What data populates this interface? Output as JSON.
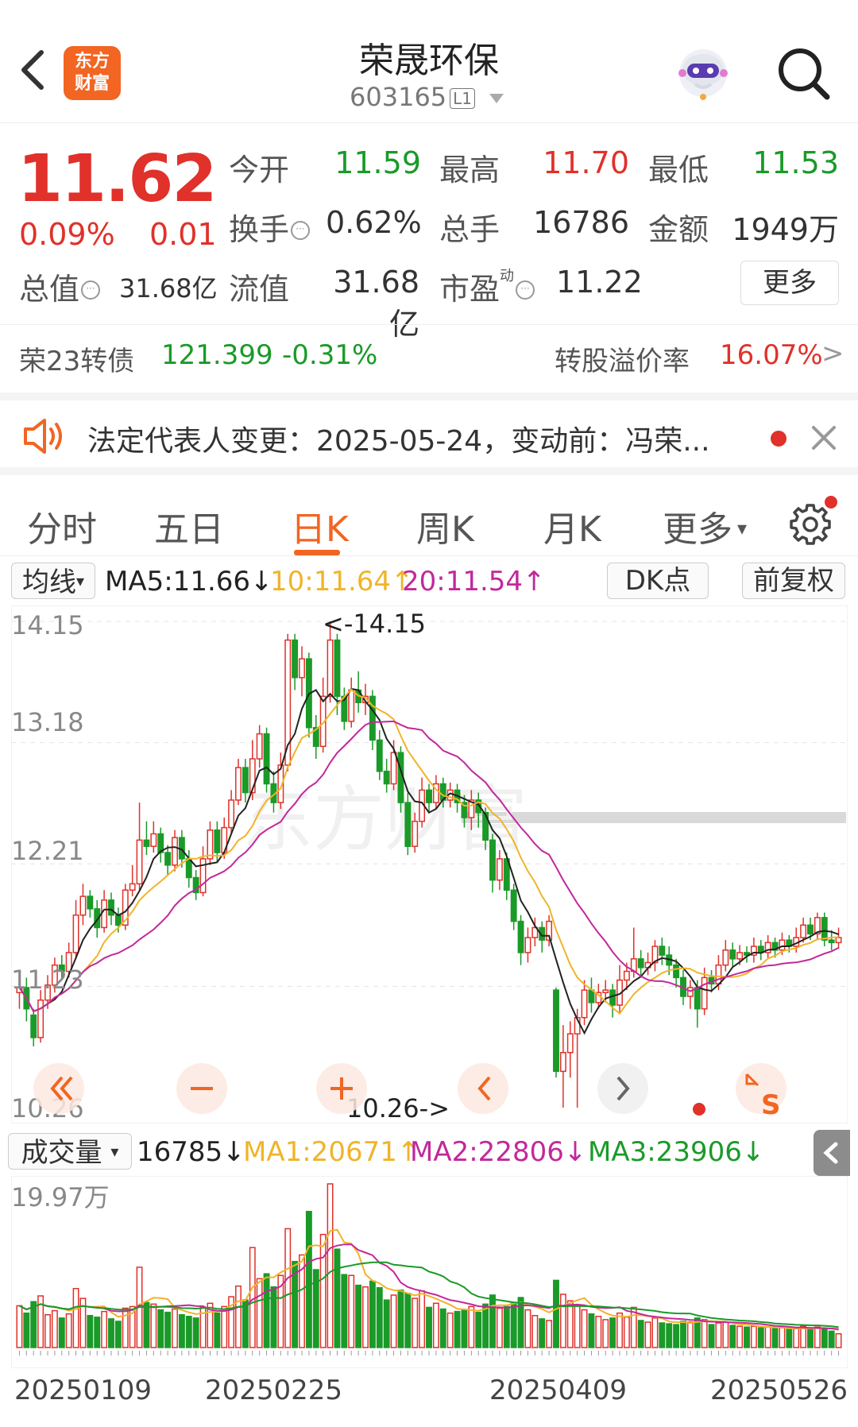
{
  "header": {
    "title": "荣晟环保",
    "code": "603165",
    "level_badge": "L1",
    "logo_line1": "东方",
    "logo_line2": "财富",
    "icons": [
      "back-arrow-icon",
      "robot-avatar-icon",
      "search-icon"
    ]
  },
  "quote": {
    "price": "11.62",
    "change_pct": "0.09%",
    "change": "0.01",
    "open_label": "今开",
    "open": "11.59",
    "high_label": "最高",
    "high": "11.70",
    "low_label": "最低",
    "low": "11.53",
    "turnover_label": "换手",
    "turnover": "0.62%",
    "volume_label": "总手",
    "volume": "16786",
    "amount_label": "金额",
    "amount": "1949万",
    "mcap_label": "总值",
    "mcap": "31.68亿",
    "float_label": "流值",
    "float": "31.68亿",
    "pe_label": "市盈",
    "pe_super": "动",
    "pe": "11.22",
    "more_button": "更多",
    "colors": {
      "up": "#e0312a",
      "down": "#1a9a28"
    }
  },
  "bond": {
    "name": "荣23转债",
    "price": "121.399",
    "change_pct": "-0.31%",
    "premium_label": "转股溢价率",
    "premium": "16.07%",
    "arrow": ">"
  },
  "notice": {
    "text": "法定代表人变更：2025-05-24，变动前：冯荣...",
    "icons": [
      "speaker-icon",
      "red-dot-icon",
      "close-icon"
    ]
  },
  "tabs": {
    "items": [
      "分时",
      "五日",
      "日K",
      "周K",
      "月K",
      "更多"
    ],
    "active": "日K",
    "more_arrow": "▾",
    "settings_icon": "gear-icon"
  },
  "ma_row": {
    "selector": "均线",
    "selector_arrow": "▾",
    "ma5": "MA5:11.66↓",
    "ma10": "10:11.64↑",
    "ma20": "20:11.54↑",
    "dk_button": "DK点",
    "fq_button": "前复权",
    "colors": {
      "ma5": "#222222",
      "ma10": "#f0b429",
      "ma20": "#c2289b"
    }
  },
  "kline_axis": {
    "y_labels": [
      "14.15",
      "13.18",
      "12.21",
      "11.23",
      "10.26"
    ],
    "max_marker": "<-14.15",
    "min_marker": "10.26->",
    "watermark": "东方财富"
  },
  "chart_controls": {
    "icons": [
      "double-left-icon",
      "zoom-out-icon",
      "zoom-in-icon",
      "left-icon",
      "right-icon",
      "expand-icon"
    ],
    "s_label": "S"
  },
  "volume_row": {
    "selector": "成交量",
    "selector_arrow": "▾",
    "vol": "16785↓",
    "ma1": "MA1:20671↑",
    "ma2": "MA2:22806↓",
    "ma3": "MA3:23906↓",
    "y_label": "19.97万",
    "colors": {
      "ma1": "#f0b429",
      "ma2": "#c2289b",
      "ma3": "#1a9a28"
    }
  },
  "dates": [
    "20250109",
    "20250225",
    "20250409",
    "20250526"
  ],
  "chart_data": {
    "type": "candlestick",
    "y_range": [
      10.26,
      14.15
    ],
    "volume_max": "19.97万",
    "candles": [
      {
        "o": 11.18,
        "c": 11.22,
        "h": 11.28,
        "l": 11.05,
        "v": 5.1
      },
      {
        "o": 11.22,
        "c": 11.05,
        "h": 11.3,
        "l": 10.95,
        "v": 4.2
      },
      {
        "o": 11.0,
        "c": 10.82,
        "h": 11.05,
        "l": 10.75,
        "v": 5.6
      },
      {
        "o": 10.82,
        "c": 11.12,
        "h": 11.2,
        "l": 10.78,
        "v": 6.3
      },
      {
        "o": 11.12,
        "c": 11.24,
        "h": 11.32,
        "l": 11.05,
        "v": 4.0
      },
      {
        "o": 11.24,
        "c": 11.4,
        "h": 11.46,
        "l": 11.18,
        "v": 4.5
      },
      {
        "o": 11.4,
        "c": 11.35,
        "h": 11.48,
        "l": 11.28,
        "v": 3.6
      },
      {
        "o": 11.35,
        "c": 11.5,
        "h": 11.58,
        "l": 11.3,
        "v": 4.1
      },
      {
        "o": 11.5,
        "c": 11.8,
        "h": 11.92,
        "l": 11.45,
        "v": 7.2
      },
      {
        "o": 11.8,
        "c": 11.95,
        "h": 12.05,
        "l": 11.72,
        "v": 6.0
      },
      {
        "o": 11.95,
        "c": 11.85,
        "h": 12.0,
        "l": 11.78,
        "v": 3.9
      },
      {
        "o": 11.85,
        "c": 11.7,
        "h": 11.92,
        "l": 11.62,
        "v": 3.7
      },
      {
        "o": 11.7,
        "c": 11.92,
        "h": 12.0,
        "l": 11.66,
        "v": 4.4
      },
      {
        "o": 11.92,
        "c": 11.8,
        "h": 11.98,
        "l": 11.72,
        "v": 3.5
      },
      {
        "o": 11.8,
        "c": 11.72,
        "h": 11.86,
        "l": 11.66,
        "v": 3.2
      },
      {
        "o": 11.72,
        "c": 12.0,
        "h": 12.05,
        "l": 11.68,
        "v": 4.8
      },
      {
        "o": 12.0,
        "c": 12.05,
        "h": 12.2,
        "l": 11.95,
        "v": 5.0
      },
      {
        "o": 12.05,
        "c": 12.4,
        "h": 12.7,
        "l": 12.0,
        "v": 9.8
      },
      {
        "o": 12.4,
        "c": 12.35,
        "h": 12.55,
        "l": 12.28,
        "v": 5.5
      },
      {
        "o": 12.35,
        "c": 12.45,
        "h": 12.55,
        "l": 12.3,
        "v": 5.3
      },
      {
        "o": 12.45,
        "c": 12.3,
        "h": 12.5,
        "l": 12.22,
        "v": 4.6
      },
      {
        "o": 12.3,
        "c": 12.2,
        "h": 12.36,
        "l": 12.12,
        "v": 4.3
      },
      {
        "o": 12.2,
        "c": 12.42,
        "h": 12.48,
        "l": 12.15,
        "v": 4.7
      },
      {
        "o": 12.42,
        "c": 12.25,
        "h": 12.48,
        "l": 12.18,
        "v": 4.0
      },
      {
        "o": 12.25,
        "c": 12.1,
        "h": 12.32,
        "l": 12.02,
        "v": 3.8
      },
      {
        "o": 12.1,
        "c": 11.98,
        "h": 12.16,
        "l": 11.92,
        "v": 3.6
      },
      {
        "o": 11.98,
        "c": 12.25,
        "h": 12.35,
        "l": 11.95,
        "v": 4.9
      },
      {
        "o": 12.25,
        "c": 12.48,
        "h": 12.55,
        "l": 12.2,
        "v": 5.4
      },
      {
        "o": 12.48,
        "c": 12.3,
        "h": 12.55,
        "l": 12.22,
        "v": 4.2
      },
      {
        "o": 12.3,
        "c": 12.5,
        "h": 12.58,
        "l": 12.25,
        "v": 5.0
      },
      {
        "o": 12.5,
        "c": 12.72,
        "h": 12.8,
        "l": 12.45,
        "v": 6.2
      },
      {
        "o": 12.72,
        "c": 12.98,
        "h": 13.05,
        "l": 12.68,
        "v": 7.5
      },
      {
        "o": 12.98,
        "c": 12.78,
        "h": 13.05,
        "l": 12.7,
        "v": 5.8
      },
      {
        "o": 12.78,
        "c": 13.05,
        "h": 13.2,
        "l": 12.72,
        "v": 12.2
      },
      {
        "o": 13.05,
        "c": 13.25,
        "h": 13.32,
        "l": 12.98,
        "v": 8.4
      },
      {
        "o": 13.25,
        "c": 12.85,
        "h": 13.3,
        "l": 12.78,
        "v": 9.0
      },
      {
        "o": 12.85,
        "c": 12.7,
        "h": 12.95,
        "l": 12.62,
        "v": 7.4
      },
      {
        "o": 12.7,
        "c": 13.0,
        "h": 13.1,
        "l": 12.65,
        "v": 8.8
      },
      {
        "o": 13.0,
        "c": 14.0,
        "h": 14.05,
        "l": 12.95,
        "v": 14.5
      },
      {
        "o": 14.0,
        "c": 13.7,
        "h": 14.05,
        "l": 13.6,
        "v": 10.5
      },
      {
        "o": 13.7,
        "c": 13.85,
        "h": 13.95,
        "l": 13.55,
        "v": 11.3
      },
      {
        "o": 13.85,
        "c": 13.3,
        "h": 13.9,
        "l": 13.22,
        "v": 16.6
      },
      {
        "o": 13.3,
        "c": 13.15,
        "h": 13.4,
        "l": 13.05,
        "v": 9.5
      },
      {
        "o": 13.15,
        "c": 13.55,
        "h": 13.7,
        "l": 13.1,
        "v": 13.8
      },
      {
        "o": 13.55,
        "c": 14.0,
        "h": 14.15,
        "l": 13.5,
        "v": 19.97
      },
      {
        "o": 14.0,
        "c": 13.55,
        "h": 14.05,
        "l": 13.4,
        "v": 12.0
      },
      {
        "o": 13.55,
        "c": 13.35,
        "h": 13.62,
        "l": 13.28,
        "v": 8.9
      },
      {
        "o": 13.35,
        "c": 13.6,
        "h": 13.7,
        "l": 13.3,
        "v": 8.8
      },
      {
        "o": 13.6,
        "c": 13.5,
        "h": 13.75,
        "l": 13.42,
        "v": 7.6
      },
      {
        "o": 13.5,
        "c": 13.55,
        "h": 13.65,
        "l": 13.4,
        "v": 7.4
      },
      {
        "o": 13.55,
        "c": 13.2,
        "h": 13.6,
        "l": 13.12,
        "v": 8.1
      },
      {
        "o": 13.2,
        "c": 12.95,
        "h": 13.28,
        "l": 12.88,
        "v": 7.3
      },
      {
        "o": 12.95,
        "c": 12.85,
        "h": 13.05,
        "l": 12.78,
        "v": 5.8
      },
      {
        "o": 12.85,
        "c": 13.1,
        "h": 13.2,
        "l": 12.8,
        "v": 6.4
      },
      {
        "o": 13.1,
        "c": 12.7,
        "h": 13.15,
        "l": 12.62,
        "v": 7.0
      },
      {
        "o": 12.7,
        "c": 12.35,
        "h": 12.78,
        "l": 12.28,
        "v": 6.6
      },
      {
        "o": 12.35,
        "c": 12.55,
        "h": 12.62,
        "l": 12.3,
        "v": 6.0
      },
      {
        "o": 12.55,
        "c": 12.8,
        "h": 12.9,
        "l": 12.5,
        "v": 6.9
      },
      {
        "o": 12.8,
        "c": 12.7,
        "h": 12.85,
        "l": 12.62,
        "v": 4.9
      },
      {
        "o": 12.7,
        "c": 12.85,
        "h": 12.92,
        "l": 12.65,
        "v": 5.4
      },
      {
        "o": 12.85,
        "c": 12.72,
        "h": 12.9,
        "l": 12.66,
        "v": 4.7
      },
      {
        "o": 12.72,
        "c": 12.8,
        "h": 12.86,
        "l": 12.66,
        "v": 4.2
      },
      {
        "o": 12.8,
        "c": 12.7,
        "h": 12.85,
        "l": 12.62,
        "v": 4.4
      },
      {
        "o": 12.7,
        "c": 12.58,
        "h": 12.76,
        "l": 12.5,
        "v": 4.6
      },
      {
        "o": 12.58,
        "c": 12.72,
        "h": 12.8,
        "l": 12.48,
        "v": 5.0
      },
      {
        "o": 12.72,
        "c": 12.62,
        "h": 12.78,
        "l": 12.5,
        "v": 4.3
      },
      {
        "o": 12.62,
        "c": 12.4,
        "h": 12.66,
        "l": 12.32,
        "v": 5.3
      },
      {
        "o": 12.4,
        "c": 12.08,
        "h": 12.45,
        "l": 11.98,
        "v": 6.4
      },
      {
        "o": 12.08,
        "c": 12.25,
        "h": 12.32,
        "l": 12.0,
        "v": 4.8
      },
      {
        "o": 12.25,
        "c": 12.0,
        "h": 12.3,
        "l": 11.92,
        "v": 5.0
      },
      {
        "o": 12.0,
        "c": 11.75,
        "h": 12.05,
        "l": 11.68,
        "v": 5.4
      },
      {
        "o": 11.75,
        "c": 11.5,
        "h": 11.8,
        "l": 11.4,
        "v": 6.1
      },
      {
        "o": 11.5,
        "c": 11.62,
        "h": 11.7,
        "l": 11.42,
        "v": 4.6
      },
      {
        "o": 11.62,
        "c": 11.7,
        "h": 11.78,
        "l": 11.55,
        "v": 3.9
      },
      {
        "o": 11.7,
        "c": 11.6,
        "h": 11.75,
        "l": 11.5,
        "v": 3.5
      },
      {
        "o": 11.6,
        "c": 11.75,
        "h": 11.8,
        "l": 11.55,
        "v": 3.3
      },
      {
        "o": 11.2,
        "c": 10.55,
        "h": 11.22,
        "l": 10.5,
        "v": 8.2
      },
      {
        "o": 10.55,
        "c": 10.7,
        "h": 10.92,
        "l": 10.26,
        "v": 6.5
      },
      {
        "o": 10.7,
        "c": 10.85,
        "h": 10.95,
        "l": 10.5,
        "v": 5.7
      },
      {
        "o": 10.85,
        "c": 10.98,
        "h": 11.05,
        "l": 10.26,
        "v": 5.2
      },
      {
        "o": 10.98,
        "c": 11.2,
        "h": 11.28,
        "l": 10.92,
        "v": 4.6
      },
      {
        "o": 11.2,
        "c": 11.1,
        "h": 11.3,
        "l": 11.02,
        "v": 4.1
      },
      {
        "o": 11.1,
        "c": 11.18,
        "h": 11.25,
        "l": 11.05,
        "v": 3.8
      },
      {
        "o": 11.18,
        "c": 11.2,
        "h": 11.28,
        "l": 11.1,
        "v": 3.4
      },
      {
        "o": 11.2,
        "c": 11.08,
        "h": 11.25,
        "l": 10.98,
        "v": 3.6
      },
      {
        "o": 11.08,
        "c": 11.28,
        "h": 11.4,
        "l": 11.02,
        "v": 4.2
      },
      {
        "o": 11.28,
        "c": 11.35,
        "h": 11.42,
        "l": 11.2,
        "v": 3.7
      },
      {
        "o": 11.35,
        "c": 11.45,
        "h": 11.7,
        "l": 11.3,
        "v": 4.9
      },
      {
        "o": 11.45,
        "c": 11.38,
        "h": 11.52,
        "l": 11.3,
        "v": 3.3
      },
      {
        "o": 11.38,
        "c": 11.42,
        "h": 11.5,
        "l": 11.32,
        "v": 3.1
      },
      {
        "o": 11.42,
        "c": 11.55,
        "h": 11.6,
        "l": 11.35,
        "v": 3.6
      },
      {
        "o": 11.55,
        "c": 11.48,
        "h": 11.62,
        "l": 11.4,
        "v": 3.0
      },
      {
        "o": 11.48,
        "c": 11.4,
        "h": 11.55,
        "l": 11.32,
        "v": 2.9
      },
      {
        "o": 11.4,
        "c": 11.3,
        "h": 11.45,
        "l": 11.22,
        "v": 2.8
      },
      {
        "o": 11.3,
        "c": 11.15,
        "h": 11.36,
        "l": 11.08,
        "v": 3.2
      },
      {
        "o": 11.15,
        "c": 11.22,
        "h": 11.28,
        "l": 11.05,
        "v": 3.1
      },
      {
        "o": 11.22,
        "c": 11.05,
        "h": 11.28,
        "l": 10.9,
        "v": 3.6
      },
      {
        "o": 11.05,
        "c": 11.3,
        "h": 11.38,
        "l": 11.0,
        "v": 3.4
      },
      {
        "o": 11.3,
        "c": 11.25,
        "h": 11.36,
        "l": 11.18,
        "v": 2.8
      },
      {
        "o": 11.25,
        "c": 11.4,
        "h": 11.48,
        "l": 11.2,
        "v": 3.0
      },
      {
        "o": 11.4,
        "c": 11.52,
        "h": 11.6,
        "l": 11.35,
        "v": 3.1
      },
      {
        "o": 11.52,
        "c": 11.45,
        "h": 11.58,
        "l": 11.38,
        "v": 2.7
      },
      {
        "o": 11.45,
        "c": 11.5,
        "h": 11.56,
        "l": 11.4,
        "v": 2.6
      },
      {
        "o": 11.5,
        "c": 11.48,
        "h": 11.55,
        "l": 11.42,
        "v": 2.5
      },
      {
        "o": 11.48,
        "c": 11.55,
        "h": 11.62,
        "l": 11.42,
        "v": 2.6
      },
      {
        "o": 11.55,
        "c": 11.5,
        "h": 11.6,
        "l": 11.44,
        "v": 2.4
      },
      {
        "o": 11.5,
        "c": 11.58,
        "h": 11.64,
        "l": 11.45,
        "v": 2.5
      },
      {
        "o": 11.58,
        "c": 11.52,
        "h": 11.62,
        "l": 11.46,
        "v": 2.3
      },
      {
        "o": 11.52,
        "c": 11.6,
        "h": 11.66,
        "l": 11.48,
        "v": 2.4
      },
      {
        "o": 11.6,
        "c": 11.55,
        "h": 11.64,
        "l": 11.5,
        "v": 2.2
      },
      {
        "o": 11.55,
        "c": 11.62,
        "h": 11.7,
        "l": 11.5,
        "v": 2.3
      },
      {
        "o": 11.62,
        "c": 11.72,
        "h": 11.78,
        "l": 11.58,
        "v": 2.6
      },
      {
        "o": 11.72,
        "c": 11.65,
        "h": 11.78,
        "l": 11.6,
        "v": 2.2
      },
      {
        "o": 11.65,
        "c": 11.78,
        "h": 11.82,
        "l": 11.6,
        "v": 2.5
      },
      {
        "o": 11.78,
        "c": 11.6,
        "h": 11.82,
        "l": 11.55,
        "v": 2.3
      },
      {
        "o": 11.6,
        "c": 11.58,
        "h": 11.68,
        "l": 11.52,
        "v": 2.0
      },
      {
        "o": 11.58,
        "c": 11.62,
        "h": 11.7,
        "l": 11.53,
        "v": 1.68
      }
    ]
  }
}
